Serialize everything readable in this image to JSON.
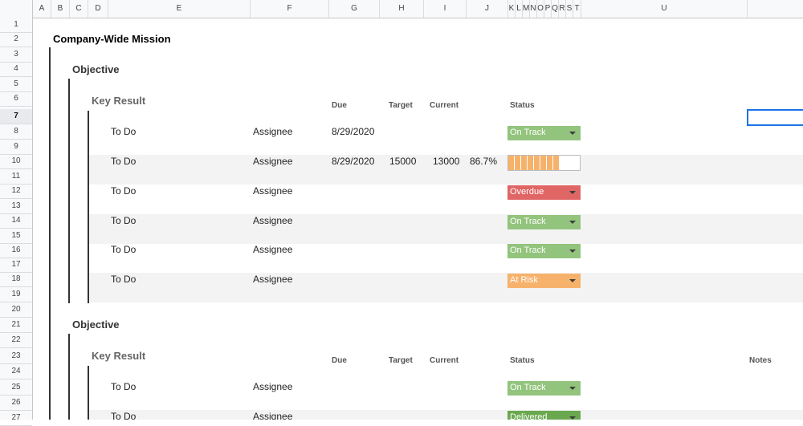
{
  "columns": [
    "A",
    "B",
    "C",
    "D",
    "E",
    "F",
    "G",
    "H",
    "I",
    "J",
    "K",
    "L",
    "M",
    "N",
    "O",
    "P",
    "Q",
    "R",
    "S",
    "T",
    "U"
  ],
  "rows": [
    "1",
    "2",
    "3",
    "4",
    "5",
    "6",
    "7",
    "8",
    "9",
    "10",
    "11",
    "12",
    "13",
    "14",
    "15",
    "16",
    "17",
    "18",
    "19",
    "20",
    "21",
    "22",
    "23",
    "24",
    "25",
    "26",
    "27"
  ],
  "selected_row": "7",
  "company_mission": "Company-Wide Mission",
  "objective_label": "Objective",
  "key_result_label": "Key Result",
  "headers": {
    "due": "Due",
    "target": "Target",
    "current": "Current",
    "status": "Status",
    "notes": "Notes"
  },
  "tasks1": [
    {
      "todo": "To Do",
      "assignee": "Assignee",
      "due": "8/29/2020",
      "target": "",
      "current": "",
      "pct": "",
      "status": "On Track",
      "status_color": "#93c47d"
    },
    {
      "todo": "To Do",
      "assignee": "Assignee",
      "due": "8/29/2020",
      "target": "15000",
      "current": "13000",
      "pct": "86.7%",
      "status": "",
      "progress": 0.867
    },
    {
      "todo": "To Do",
      "assignee": "Assignee",
      "due": "",
      "target": "",
      "current": "",
      "pct": "",
      "status": "Overdue",
      "status_color": "#e06666"
    },
    {
      "todo": "To Do",
      "assignee": "Assignee",
      "due": "",
      "target": "",
      "current": "",
      "pct": "",
      "status": "On Track",
      "status_color": "#93c47d"
    },
    {
      "todo": "To Do",
      "assignee": "Assignee",
      "due": "",
      "target": "",
      "current": "",
      "pct": "",
      "status": "On Track",
      "status_color": "#93c47d"
    },
    {
      "todo": "To Do",
      "assignee": "Assignee",
      "due": "",
      "target": "",
      "current": "",
      "pct": "",
      "status": "At Risk",
      "status_color": "#f6b26b"
    }
  ],
  "tasks2": [
    {
      "todo": "To Do",
      "assignee": "Assignee",
      "status": "On Track",
      "status_color": "#93c47d"
    },
    {
      "todo": "To Do",
      "assignee": "Assignee",
      "status": "Delivered",
      "status_color": "#6aa84f"
    }
  ],
  "progress_color": "#f6b26b"
}
